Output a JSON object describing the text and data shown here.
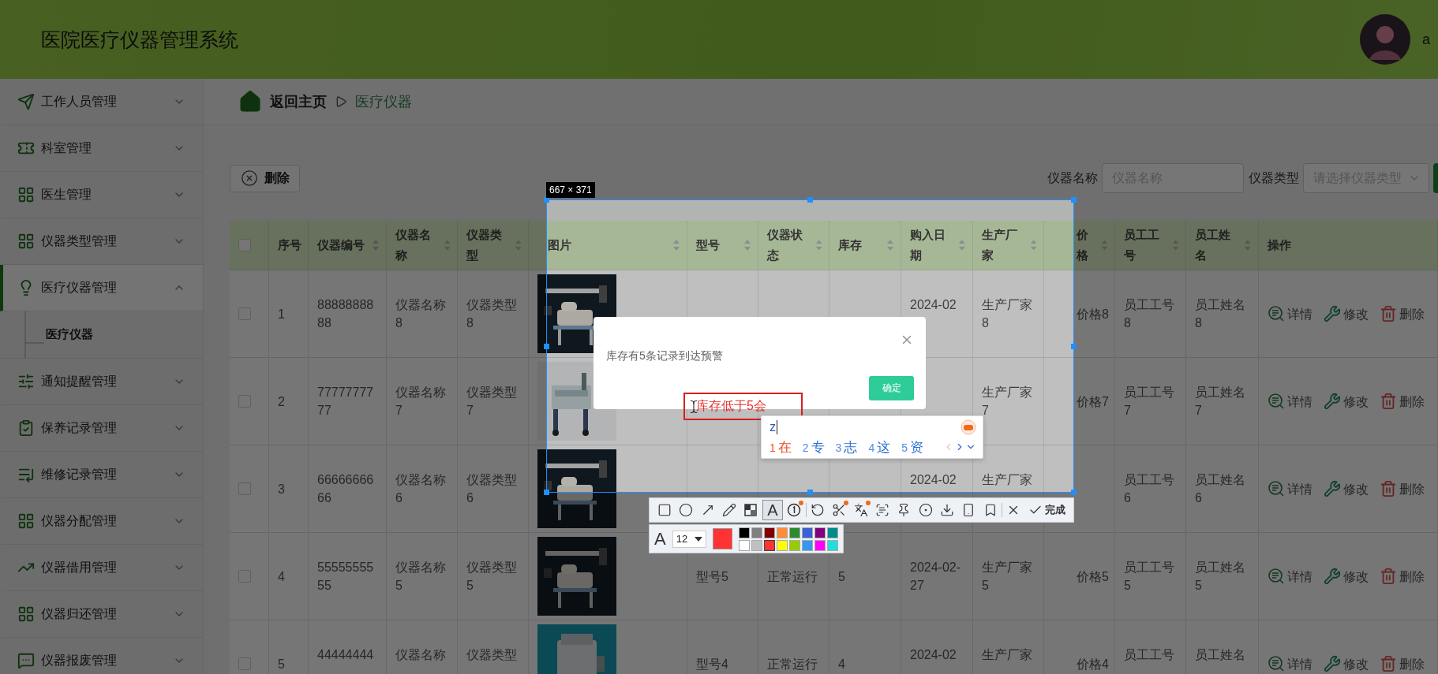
{
  "header": {
    "title": "医院医疗仪器管理系统",
    "user": "a"
  },
  "sidebar": {
    "items": [
      {
        "label": "工作人员管理",
        "expanded": false,
        "selected": false
      },
      {
        "label": "科室管理",
        "expanded": false,
        "selected": false
      },
      {
        "label": "医生管理",
        "expanded": false,
        "selected": false
      },
      {
        "label": "仪器类型管理",
        "expanded": false,
        "selected": false
      },
      {
        "label": "医疗仪器管理",
        "expanded": true,
        "selected": true,
        "children": [
          {
            "label": "医疗仪器",
            "selected": true
          }
        ]
      },
      {
        "label": "通知提醒管理",
        "expanded": false,
        "selected": false
      },
      {
        "label": "保养记录管理",
        "expanded": false,
        "selected": false
      },
      {
        "label": "维修记录管理",
        "expanded": false,
        "selected": false
      },
      {
        "label": "仪器分配管理",
        "expanded": false,
        "selected": false
      },
      {
        "label": "仪器借用管理",
        "expanded": false,
        "selected": false
      },
      {
        "label": "仪器归还管理",
        "expanded": false,
        "selected": false
      },
      {
        "label": "仪器报废管理",
        "expanded": false,
        "selected": false
      }
    ]
  },
  "breadcrumb": {
    "home": "返回主页",
    "current": "医疗仪器"
  },
  "toolbar": {
    "delete": "删除"
  },
  "search": {
    "fields": [
      {
        "kind": "input",
        "label": "仪器名称",
        "placeholder": "仪器名称"
      },
      {
        "kind": "select",
        "label": "仪器类型",
        "placeholder": "请选择仪器类型"
      }
    ]
  },
  "table": {
    "columns": [
      {
        "kind": "checkbox",
        "checked": false
      },
      {
        "kind": "text",
        "label": "序号",
        "sortable": false
      },
      {
        "kind": "text",
        "label": "仪器编号",
        "sortable": true
      },
      {
        "kind": "text",
        "label": "仪器名称",
        "sortable": true
      },
      {
        "kind": "text",
        "label": "仪器类型",
        "sortable": true
      },
      {
        "kind": "picture",
        "label": "图片",
        "sortable": true
      },
      {
        "kind": "text",
        "label": "型号",
        "sortable": true
      },
      {
        "kind": "text",
        "label": "仪器状态",
        "sortable": true
      },
      {
        "kind": "text",
        "label": "库存",
        "sortable": true
      },
      {
        "kind": "text",
        "label": "购入日期",
        "sortable": true
      },
      {
        "kind": "text",
        "label": "生产厂家",
        "sortable": true
      },
      {
        "kind": "text",
        "label": "价格",
        "sortable": true
      },
      {
        "kind": "text",
        "label": "员工工号",
        "sortable": true
      },
      {
        "kind": "text",
        "label": "员工姓名",
        "sortable": true
      },
      {
        "kind": "actions",
        "label": "操作",
        "sortable": false
      }
    ],
    "rows": [
      {
        "checked": false,
        "index": "1",
        "code": "8888888888",
        "name": "仪器名称8",
        "type": "仪器类型8",
        "date": "2024-02",
        "maker": "生产厂家8",
        "price": "价格8",
        "staff_no": "员工工号8",
        "staff_name": "员工姓名8",
        "actions": [
          {
            "kind": "detail",
            "label": "详情"
          },
          {
            "kind": "edit",
            "label": "修改"
          },
          {
            "kind": "delete",
            "label": "删除"
          }
        ]
      },
      {
        "checked": false,
        "index": "2",
        "code": "7777777777",
        "name": "仪器名称7",
        "type": "仪器类型7",
        "maker": "生产厂家7",
        "price": "价格7",
        "staff_no": "员工工号7",
        "staff_name": "员工姓名7",
        "actions": [
          {
            "kind": "detail",
            "label": "详情"
          },
          {
            "kind": "edit",
            "label": "修改"
          },
          {
            "kind": "delete",
            "label": "删除"
          }
        ]
      },
      {
        "checked": false,
        "index": "3",
        "code": "6666666666",
        "name": "仪器名称6",
        "type": "仪器类型6",
        "date": "2024-02",
        "maker": "生产厂家",
        "staff_no": "员工工号6",
        "staff_name": "员工姓名6",
        "actions": [
          {
            "kind": "detail",
            "label": "详情"
          },
          {
            "kind": "edit",
            "label": "修改"
          },
          {
            "kind": "delete",
            "label": "删除"
          }
        ]
      },
      {
        "checked": false,
        "index": "4",
        "code": "5555555555",
        "name": "仪器名称5",
        "type": "仪器类型5",
        "model": "型号5",
        "status": "正常运行",
        "stock": "5",
        "date": "2024-02-27",
        "maker": "生产厂家5",
        "price": "价格5",
        "staff_no": "员工工号5",
        "staff_name": "员工姓名5",
        "actions": [
          {
            "kind": "detail",
            "label": "详情"
          },
          {
            "kind": "edit",
            "label": "修改"
          },
          {
            "kind": "delete",
            "label": "删除"
          }
        ]
      },
      {
        "checked": false,
        "index": "5",
        "code": "44444444",
        "name": "仪器名称",
        "type": "仪器类型",
        "model": "型号4",
        "status": "正常运行",
        "stock": "4",
        "date": "2024-02",
        "maker": "生产厂家",
        "price": "价格4",
        "staff_no": "员工工号",
        "staff_name": "员工姓名",
        "actions": [
          {
            "kind": "detail",
            "label": "详情"
          },
          {
            "kind": "edit",
            "label": "修改"
          },
          {
            "kind": "delete",
            "label": "删除"
          }
        ]
      }
    ]
  },
  "dialog": {
    "message": "库存有5条记录到达预警",
    "confirm": "确定"
  },
  "capture": {
    "size_label": "667 × 371",
    "annotation": "库存低于5会",
    "ime": {
      "input": "z",
      "candidates": [
        {
          "index": "1",
          "text": "在",
          "selected": true
        },
        {
          "index": "2",
          "text": "专",
          "selected": false
        },
        {
          "index": "3",
          "text": "志",
          "selected": false
        },
        {
          "index": "4",
          "text": "这",
          "selected": false
        },
        {
          "index": "5",
          "text": "资",
          "selected": false
        }
      ]
    },
    "tools": [
      {
        "kind": "rect",
        "selected": false
      },
      {
        "kind": "ellipse",
        "selected": false
      },
      {
        "kind": "arrow",
        "selected": false
      },
      {
        "kind": "pencil",
        "selected": false
      },
      {
        "kind": "mosaic",
        "selected": false
      },
      {
        "kind": "text",
        "label": "A",
        "selected": true
      },
      {
        "kind": "step",
        "selected": false,
        "badge": true
      },
      {
        "kind": "divider"
      },
      {
        "kind": "undo"
      },
      {
        "kind": "cut",
        "badge": true
      },
      {
        "kind": "translate",
        "badge": true
      },
      {
        "kind": "ocr"
      },
      {
        "kind": "pin"
      },
      {
        "kind": "record"
      },
      {
        "kind": "download"
      },
      {
        "kind": "phone"
      },
      {
        "kind": "bookmark"
      },
      {
        "kind": "divider"
      },
      {
        "kind": "close"
      },
      {
        "kind": "done",
        "label": "完成"
      }
    ],
    "text_style": {
      "font_label": "A",
      "size": "12",
      "palette": [
        {
          "color": "#000000",
          "selected": false
        },
        {
          "color": "#808080",
          "selected": false
        },
        {
          "color": "#800000",
          "selected": false
        },
        {
          "color": "#ff8c3a",
          "selected": false
        },
        {
          "color": "#2e8b2e",
          "selected": false
        },
        {
          "color": "#3a5fd6",
          "selected": false
        },
        {
          "color": "#800080",
          "selected": false
        },
        {
          "color": "#008b8b",
          "selected": false
        },
        {
          "color": "#ffffff",
          "selected": false
        },
        {
          "color": "#c0c0c0",
          "selected": false
        },
        {
          "color": "#ff3333",
          "selected": true
        },
        {
          "color": "#ffff00",
          "selected": false
        },
        {
          "color": "#99cc00",
          "selected": false
        },
        {
          "color": "#3399ee",
          "selected": false
        },
        {
          "color": "#ff00ff",
          "selected": false
        },
        {
          "color": "#22dddd",
          "selected": false
        }
      ]
    }
  }
}
